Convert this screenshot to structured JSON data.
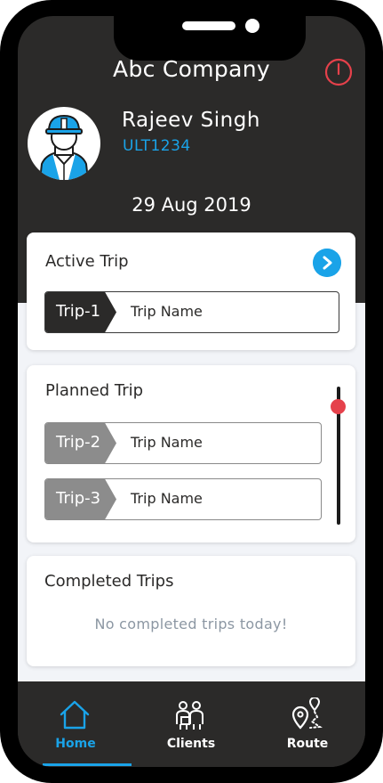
{
  "header": {
    "company": "Abc Company",
    "power_icon": "power-icon"
  },
  "user": {
    "name": "Rajeev Singh",
    "id": "ULT1234",
    "avatar_icon": "worker-avatar-icon"
  },
  "date": "29 Aug 2019",
  "active_trip": {
    "title": "Active Trip",
    "trip": {
      "tag": "Trip-1",
      "name": "Trip Name"
    },
    "play_icon": "play-icon"
  },
  "planned_trip": {
    "title": "Planned Trip",
    "trips": [
      {
        "tag": "Trip-2",
        "name": "Trip Name"
      },
      {
        "tag": "Trip-3",
        "name": "Trip Name"
      }
    ]
  },
  "completed_trips": {
    "title": "Completed Trips",
    "empty_message": "No completed trips today!"
  },
  "tabs": [
    {
      "label": "Home",
      "icon": "home-icon",
      "active": true
    },
    {
      "label": "Clients",
      "icon": "clients-icon",
      "active": false
    },
    {
      "label": "Route",
      "icon": "route-icon",
      "active": false
    }
  ],
  "colors": {
    "accent": "#1aa3e8",
    "dark": "#2b2a29",
    "power": "#e5414b",
    "planned_tag": "#8c8c8c"
  }
}
